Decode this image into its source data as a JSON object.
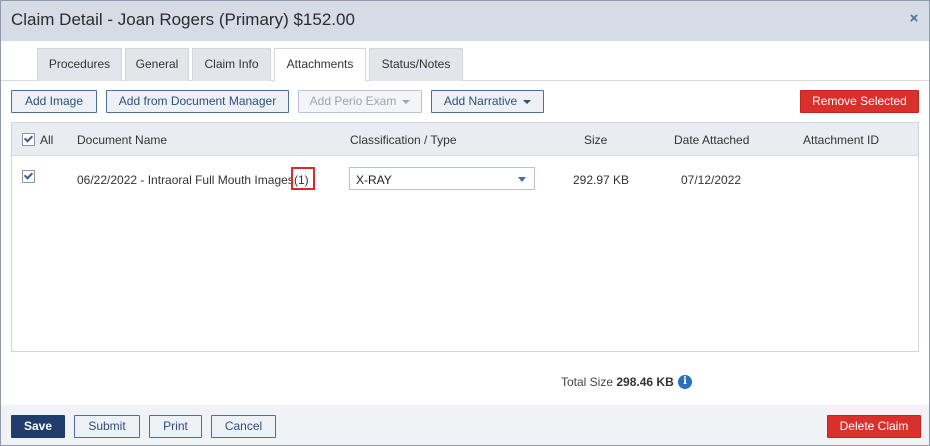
{
  "window": {
    "title": "Claim Detail - Joan Rogers (Primary) $152.00",
    "close_glyph": "×"
  },
  "tabs": [
    {
      "label": "Procedures"
    },
    {
      "label": "General"
    },
    {
      "label": "Claim Info"
    },
    {
      "label": "Attachments"
    },
    {
      "label": "Status/Notes"
    }
  ],
  "active_tab": "Attachments",
  "toolbar": {
    "add_image": "Add Image",
    "add_from_document_manager": "Add from Document Manager",
    "add_perio_exam": "Add Perio Exam",
    "add_narrative": "Add Narrative",
    "remove_selected": "Remove Selected"
  },
  "grid": {
    "columns": {
      "all": "All",
      "document_name": "Document Name",
      "classification": "Classification / Type",
      "size": "Size",
      "date_attached": "Date Attached",
      "attachment_id": "Attachment ID"
    },
    "rows": [
      {
        "checked": true,
        "document_name": "06/22/2022 - Intraoral Full Mouth Images",
        "count": "(1)",
        "classification": "X-RAY",
        "size": "292.97 KB",
        "date_attached": "07/12/2022",
        "attachment_id": ""
      }
    ]
  },
  "totals": {
    "label": "Total Size",
    "value": "298.46 KB",
    "info_glyph": "i"
  },
  "footer": {
    "save": "Save",
    "submit": "Submit",
    "print": "Print",
    "cancel": "Cancel",
    "delete_claim": "Delete Claim"
  },
  "colors": {
    "titlebar": "#d6dce6",
    "accent_border": "#4a6f9c",
    "danger": "#d9302c",
    "primary": "#1f3c6b",
    "highlight_box": "#e0282a"
  },
  "icons": {
    "close": "close-icon",
    "caret": "chevron-down-icon",
    "check": "check-icon",
    "info": "info-icon"
  }
}
